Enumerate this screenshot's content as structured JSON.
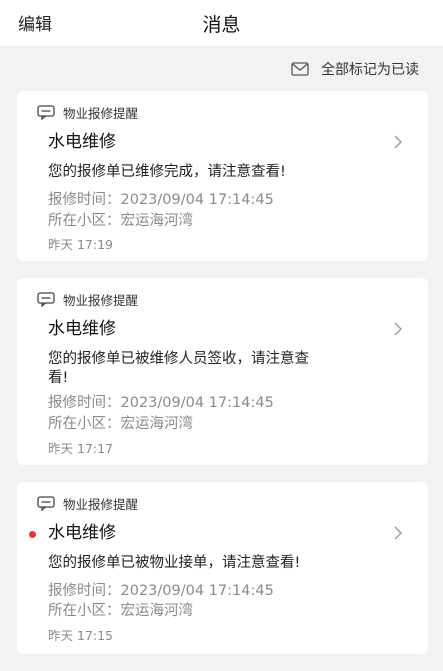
{
  "header": {
    "edit_label": "编辑",
    "title": "消息"
  },
  "toolbar": {
    "mark_all_label": "全部标记为已读"
  },
  "messages": [
    {
      "category": "物业报修提醒",
      "title": "水电维修",
      "body": "您的报修单已维修完成，请注意查看!",
      "time_label": "报修时间：",
      "time_value": "2023/09/04 17:14:45",
      "community_label": "所在小区：",
      "community_value": "宏运海河湾",
      "received": "昨天 17:19",
      "unread": false
    },
    {
      "category": "物业报修提醒",
      "title": "水电维修",
      "body_line1": "您的报修单已被维修人员签收，请注意查",
      "body_line2": "看!",
      "time_label": "报修时间：",
      "time_value": "2023/09/04 17:14:45",
      "community_label": "所在小区：",
      "community_value": "宏运海河湾",
      "received": "昨天 17:17",
      "unread": false
    },
    {
      "category": "物业报修提醒",
      "title": "水电维修",
      "body": "您的报修单已被物业接单，请注意查看!",
      "time_label": "报修时间：",
      "time_value": "2023/09/04 17:14:45",
      "community_label": "所在小区：",
      "community_value": "宏运海河湾",
      "received": "昨天 17:15",
      "unread": true
    }
  ],
  "colors": {
    "unread_dot": "#e8343c",
    "background": "#f2f2f2",
    "card": "#ffffff"
  },
  "icons": {
    "mark_all": "envelope-icon",
    "category": "message-icon",
    "open": "chevron-right-icon"
  }
}
